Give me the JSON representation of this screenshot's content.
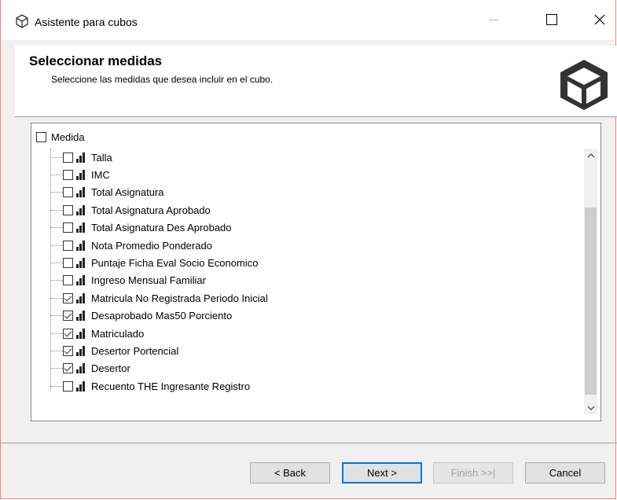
{
  "window": {
    "title": "Asistente para cubos"
  },
  "header": {
    "title": "Seleccionar medidas",
    "subtitle": "Seleccione las medidas que desea incluir en el cubo."
  },
  "list": {
    "header_label": "Medida",
    "header_checked": false,
    "items": [
      {
        "label": "Talla",
        "checked": false
      },
      {
        "label": "IMC",
        "checked": false
      },
      {
        "label": "Total Asignatura",
        "checked": false
      },
      {
        "label": "Total Asignatura Aprobado",
        "checked": false
      },
      {
        "label": "Total Asignatura Des Aprobado",
        "checked": false
      },
      {
        "label": "Nota Promedio Ponderado",
        "checked": false
      },
      {
        "label": "Puntaje Ficha Eval Socio Economico",
        "checked": false
      },
      {
        "label": "Ingreso Mensual Familiar",
        "checked": false
      },
      {
        "label": "Matricula No Registrada Periodo Inicial",
        "checked": true
      },
      {
        "label": "Desaprobado Mas50 Porciento",
        "checked": true
      },
      {
        "label": "Matriculado",
        "checked": true
      },
      {
        "label": "Desertor Portencial",
        "checked": true
      },
      {
        "label": "Desertor",
        "checked": true
      },
      {
        "label": "Recuento THE Ingresante Registro",
        "checked": false
      }
    ]
  },
  "buttons": {
    "back": "< Back",
    "next": "Next >",
    "finish": "Finish >>|",
    "cancel": "Cancel"
  },
  "icons": {
    "app": "cube-icon",
    "minimize": "minimize-icon",
    "maximize": "maximize-icon",
    "close": "close-icon",
    "measure": "bar-chart-icon"
  },
  "colors": {
    "accent": "#0078d7",
    "border": "#f08080"
  }
}
